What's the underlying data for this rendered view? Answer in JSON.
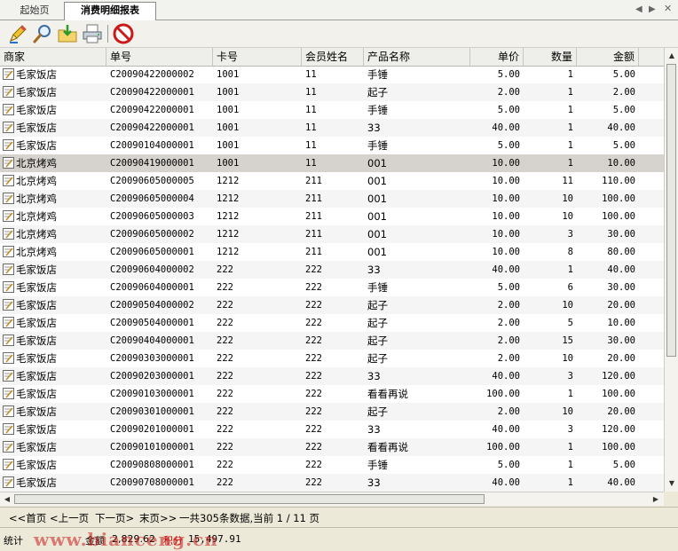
{
  "tabs": [
    {
      "label": "起始页"
    },
    {
      "label": "消费明细报表"
    }
  ],
  "toolbar": [
    {
      "icon": "edit-pencil-icon"
    },
    {
      "icon": "search-magnifier-icon"
    },
    {
      "icon": "export-folder-icon"
    },
    {
      "icon": "print-icon"
    },
    {
      "icon": "close-stop-icon"
    }
  ],
  "table": {
    "headers": [
      "商家",
      "单号",
      "卡号",
      "会员姓名",
      "产品名称",
      "单价",
      "数量",
      "金额"
    ],
    "rows": [
      [
        "毛家饭店",
        "C20090422000002",
        "1001",
        "11",
        "手锤",
        "5.00",
        "1",
        "5.00"
      ],
      [
        "毛家饭店",
        "C20090422000001",
        "1001",
        "11",
        "起子",
        "2.00",
        "1",
        "2.00"
      ],
      [
        "毛家饭店",
        "C20090422000001",
        "1001",
        "11",
        "手锤",
        "5.00",
        "1",
        "5.00"
      ],
      [
        "毛家饭店",
        "C20090422000001",
        "1001",
        "11",
        "33",
        "40.00",
        "1",
        "40.00"
      ],
      [
        "毛家饭店",
        "C20090104000001",
        "1001",
        "11",
        "手锤",
        "5.00",
        "1",
        "5.00"
      ],
      [
        "北京烤鸡",
        "C20090419000001",
        "1001",
        "11",
        "001",
        "10.00",
        "1",
        "10.00"
      ],
      [
        "北京烤鸡",
        "C20090605000005",
        "1212",
        "211",
        "001",
        "10.00",
        "11",
        "110.00"
      ],
      [
        "北京烤鸡",
        "C20090605000004",
        "1212",
        "211",
        "001",
        "10.00",
        "10",
        "100.00"
      ],
      [
        "北京烤鸡",
        "C20090605000003",
        "1212",
        "211",
        "001",
        "10.00",
        "10",
        "100.00"
      ],
      [
        "北京烤鸡",
        "C20090605000002",
        "1212",
        "211",
        "001",
        "10.00",
        "3",
        "30.00"
      ],
      [
        "北京烤鸡",
        "C20090605000001",
        "1212",
        "211",
        "001",
        "10.00",
        "8",
        "80.00"
      ],
      [
        "毛家饭店",
        "C20090604000002",
        "222",
        "222",
        "33",
        "40.00",
        "1",
        "40.00"
      ],
      [
        "毛家饭店",
        "C20090604000001",
        "222",
        "222",
        "手锤",
        "5.00",
        "6",
        "30.00"
      ],
      [
        "毛家饭店",
        "C20090504000002",
        "222",
        "222",
        "起子",
        "2.00",
        "10",
        "20.00"
      ],
      [
        "毛家饭店",
        "C20090504000001",
        "222",
        "222",
        "起子",
        "2.00",
        "5",
        "10.00"
      ],
      [
        "毛家饭店",
        "C20090404000001",
        "222",
        "222",
        "起子",
        "2.00",
        "15",
        "30.00"
      ],
      [
        "毛家饭店",
        "C20090303000001",
        "222",
        "222",
        "起子",
        "2.00",
        "10",
        "20.00"
      ],
      [
        "毛家饭店",
        "C20090203000001",
        "222",
        "222",
        "33",
        "40.00",
        "3",
        "120.00"
      ],
      [
        "毛家饭店",
        "C20090103000001",
        "222",
        "222",
        "看看再说",
        "100.00",
        "1",
        "100.00"
      ],
      [
        "毛家饭店",
        "C20090301000001",
        "222",
        "222",
        "起子",
        "2.00",
        "10",
        "20.00"
      ],
      [
        "毛家饭店",
        "C20090201000001",
        "222",
        "222",
        "33",
        "40.00",
        "3",
        "120.00"
      ],
      [
        "毛家饭店",
        "C20090101000001",
        "222",
        "222",
        "看看再说",
        "100.00",
        "1",
        "100.00"
      ],
      [
        "毛家饭店",
        "C20090808000001",
        "222",
        "222",
        "手锤",
        "5.00",
        "1",
        "5.00"
      ],
      [
        "毛家饭店",
        "C20090708000001",
        "222",
        "222",
        "33",
        "40.00",
        "1",
        "40.00"
      ]
    ],
    "selected_row": 5
  },
  "pager": {
    "first": "<<首页",
    "prev": "<上一页",
    "next": "下一页>",
    "last": "末页>>",
    "info": "一共305条数据,当前 1 / 11 页"
  },
  "status": {
    "label1": "统计",
    "label2": "金额",
    "partial_value": "2,829.62",
    "points_label": "积分",
    "points_value": "15,497.91",
    "watermark": "www.bianceng.cn"
  },
  "colors": {
    "selected_row": "#d6d3ce",
    "points_label": "#c00000",
    "watermark": "#c81e1e"
  }
}
